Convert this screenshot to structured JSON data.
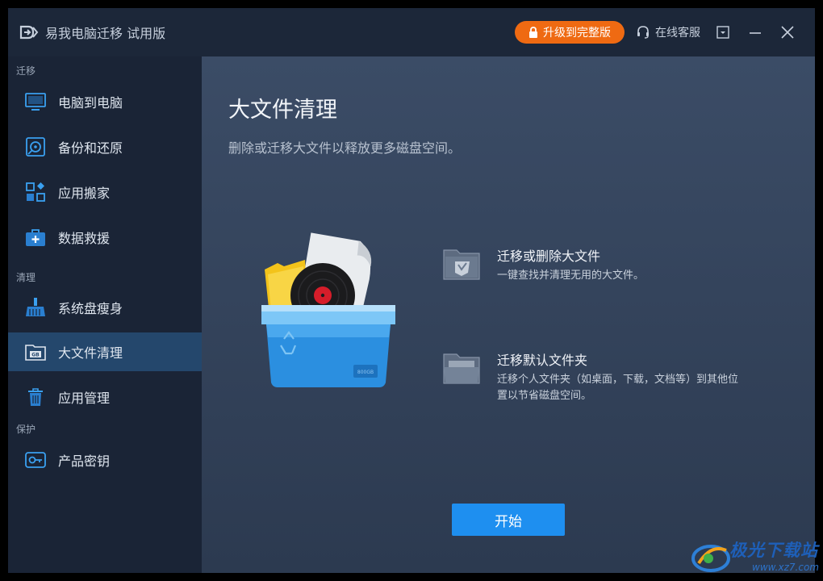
{
  "app": {
    "title": "易我电脑迁移 试用版"
  },
  "titlebar": {
    "upgrade_label": "升级到完整版",
    "support_label": "在线客服"
  },
  "sidebar": {
    "sections": [
      {
        "label": "迁移"
      },
      {
        "label": "清理"
      },
      {
        "label": "保护"
      }
    ],
    "items": [
      {
        "label": "电脑到电脑",
        "icon": "monitor-icon"
      },
      {
        "label": "备份和还原",
        "icon": "backup-disc-icon"
      },
      {
        "label": "应用搬家",
        "icon": "apps-grid-icon"
      },
      {
        "label": "数据救援",
        "icon": "first-aid-kit-icon"
      },
      {
        "label": "系统盘瘦身",
        "icon": "broom-icon"
      },
      {
        "label": "大文件清理",
        "icon": "gb-folder-icon",
        "active": true
      },
      {
        "label": "应用管理",
        "icon": "trash-icon"
      },
      {
        "label": "产品密钥",
        "icon": "key-icon"
      }
    ]
  },
  "main": {
    "title": "大文件清理",
    "subtitle": "删除或迁移大文件以释放更多磁盘空间。",
    "features": [
      {
        "title": "迁移或删除大文件",
        "desc": "一键查找并清理无用的大文件。",
        "icon": "folder-shield-icon"
      },
      {
        "title": "迁移默认文件夹",
        "desc": "迁移个人文件夹（如桌面，下载，文档等）到其他位置以节省磁盘空间。",
        "icon": "open-folder-icon"
      }
    ],
    "start_label": "开始",
    "illustration_badge": "800GB"
  },
  "watermark": {
    "text": "极光下载站",
    "url": "www.xz7.com"
  },
  "colors": {
    "accent": "#1e8ff0",
    "upgrade": "#ef6a12",
    "active_nav": "#24476c"
  }
}
